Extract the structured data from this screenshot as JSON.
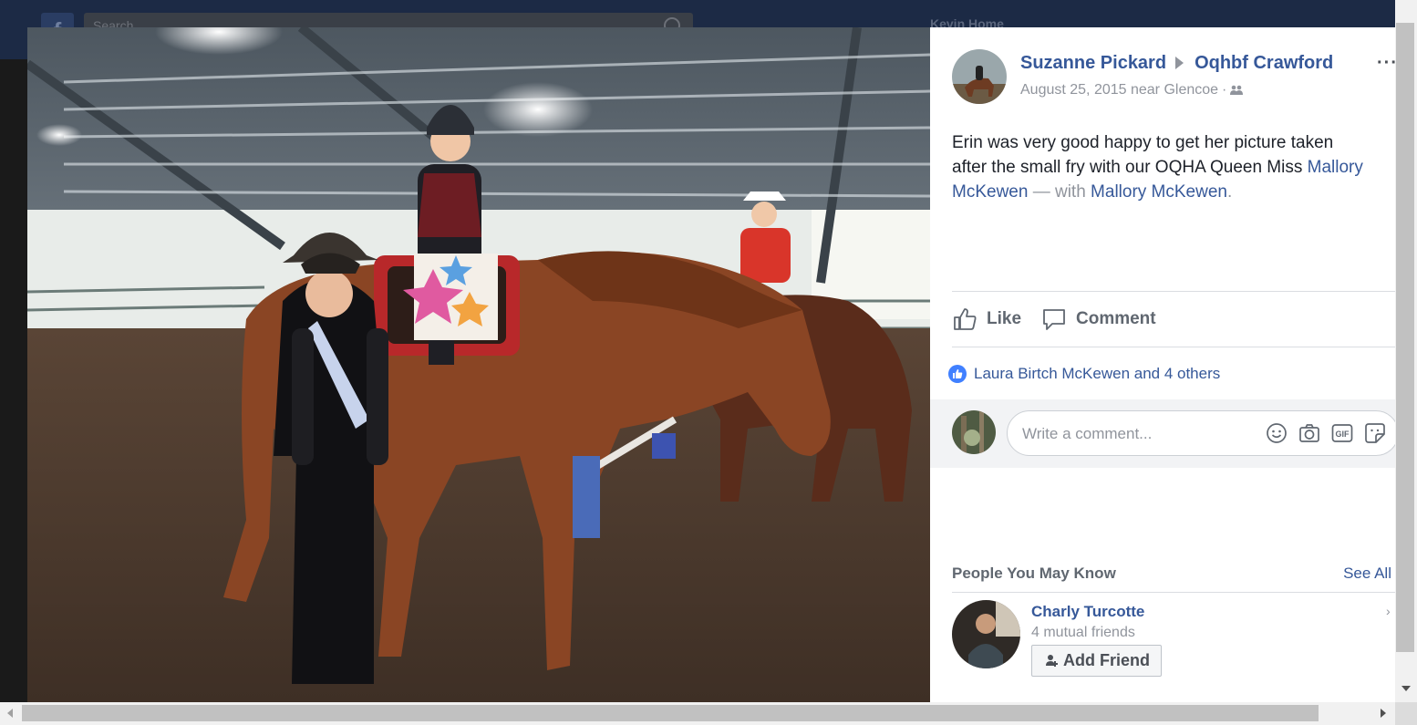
{
  "background": {
    "search_placeholder": "Search",
    "user_name": "Kevin   Home"
  },
  "post": {
    "author": "Suzanne Pickard",
    "group": "Oqhbf Crawford",
    "date": "August 25, 2015 near Glencoe",
    "separator": "·",
    "more_label": "···",
    "text_main": "Erin was very good happy to get her picture taken after the small fry with our OQHA Queen Miss ",
    "tag_1": "Mallory McKewen",
    "with_text": " — with ",
    "tag_2": "Mallory McKewen",
    "period": "."
  },
  "actions": {
    "like_label": "Like",
    "comment_label": "Comment"
  },
  "reactions": {
    "text": "Laura Birtch McKewen and 4 others"
  },
  "comment": {
    "placeholder": "Write a comment..."
  },
  "pymk": {
    "title": "People You May Know",
    "see_all": "See All",
    "person_name": "Charly Turcotte",
    "mutual": "4 mutual friends",
    "add_friend_label": "Add Friend",
    "chevron": "›"
  },
  "colors": {
    "link": "#365899",
    "muted": "#90949c",
    "like_badge": "#4080ff"
  }
}
